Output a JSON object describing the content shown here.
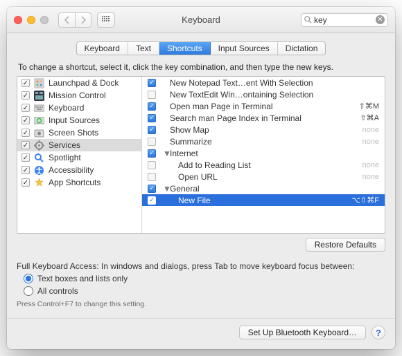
{
  "window": {
    "title": "Keyboard"
  },
  "search": {
    "value": "key"
  },
  "tabs": [
    "Keyboard",
    "Text",
    "Shortcuts",
    "Input Sources",
    "Dictation"
  ],
  "selected_tab": 2,
  "instruction": "To change a shortcut, select it, click the key combination, and then type the new keys.",
  "categories": [
    {
      "icon": "launchpad",
      "label": "Launchpad & Dock",
      "checked": true
    },
    {
      "icon": "mission",
      "label": "Mission Control",
      "checked": true
    },
    {
      "icon": "keyboard",
      "label": "Keyboard",
      "checked": true
    },
    {
      "icon": "input",
      "label": "Input Sources",
      "checked": true
    },
    {
      "icon": "screenshot",
      "label": "Screen Shots",
      "checked": true
    },
    {
      "icon": "services",
      "label": "Services",
      "checked": true,
      "selected": true
    },
    {
      "icon": "spotlight",
      "label": "Spotlight",
      "checked": true
    },
    {
      "icon": "a11y",
      "label": "Accessibility",
      "checked": true
    },
    {
      "icon": "appshort",
      "label": "App Shortcuts",
      "checked": true
    }
  ],
  "shortcut_rows": [
    {
      "type": "item",
      "checked": true,
      "label": "New Notepad Text…ent With Selection",
      "shortcut": ""
    },
    {
      "type": "item",
      "checked": false,
      "label": "New TextEdit Win…ontaining Selection",
      "shortcut": ""
    },
    {
      "type": "item",
      "checked": true,
      "label": "Open man Page in Terminal",
      "shortcut": "⇧⌘M"
    },
    {
      "type": "item",
      "checked": true,
      "label": "Search man Page Index in Terminal",
      "shortcut": "⇧⌘A"
    },
    {
      "type": "item",
      "checked": true,
      "label": "Show Map",
      "shortcut": "none"
    },
    {
      "type": "item",
      "checked": false,
      "label": "Summarize",
      "shortcut": "none"
    },
    {
      "type": "group",
      "checked": true,
      "label": "Internet"
    },
    {
      "type": "item",
      "checked": false,
      "label": "Add to Reading List",
      "shortcut": "none",
      "indent": true
    },
    {
      "type": "item",
      "checked": false,
      "label": "Open URL",
      "shortcut": "none",
      "indent": true
    },
    {
      "type": "group",
      "checked": true,
      "label": "General"
    },
    {
      "type": "item",
      "checked": true,
      "label": "New File",
      "shortcut": "⌥⇧⌘F",
      "indent": true,
      "selected": true
    }
  ],
  "restore_button": "Restore Defaults",
  "fka": {
    "prompt": "Full Keyboard Access: In windows and dialogs, press Tab to move keyboard focus between:",
    "opt1": "Text boxes and lists only",
    "opt2": "All controls",
    "selected": 0,
    "hint": "Press Control+F7 to change this setting."
  },
  "footer": {
    "bluetooth": "Set Up Bluetooth Keyboard…"
  }
}
